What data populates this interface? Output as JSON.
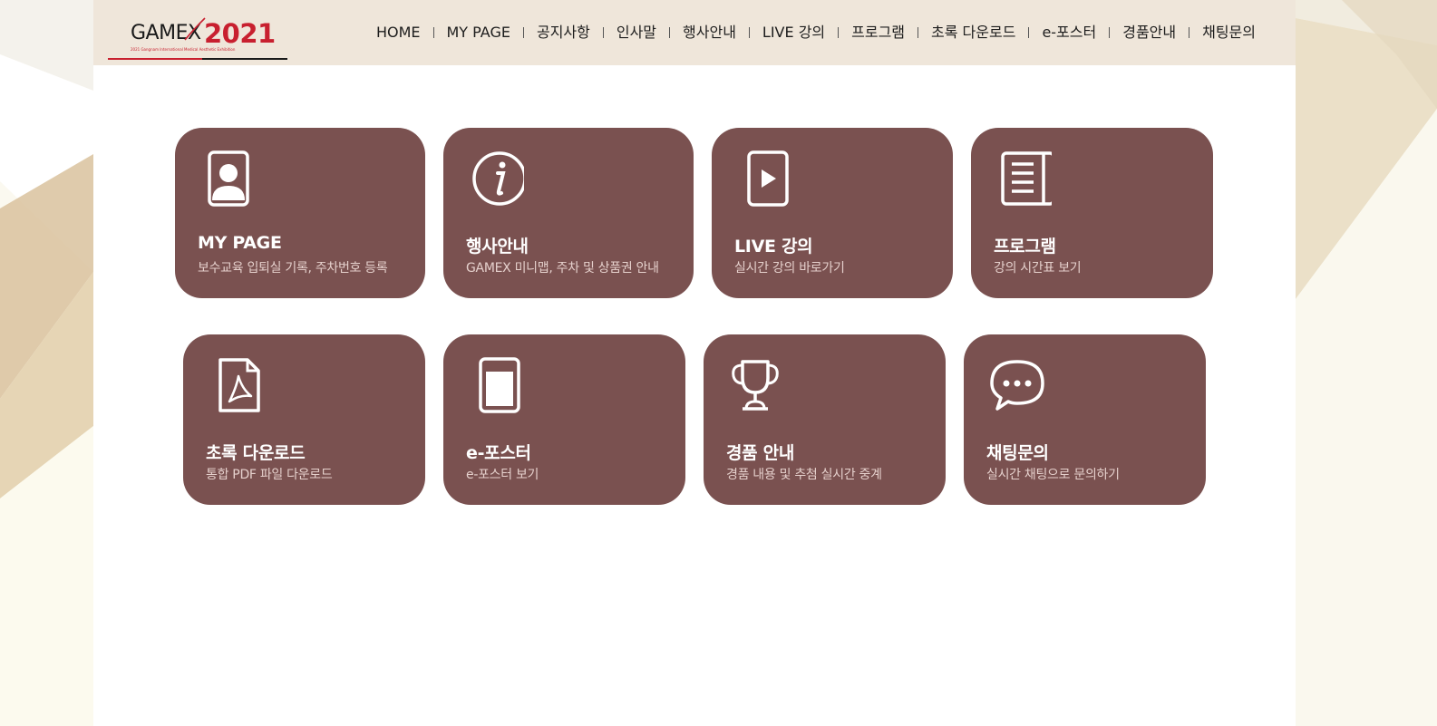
{
  "logo": {
    "brand": "GAMEX",
    "year": "2021",
    "tagline": "2021 Gangnam International Medical Aesthetic Exhibition"
  },
  "nav": {
    "items": [
      "HOME",
      "MY PAGE",
      "공지사항",
      "인사말",
      "행사안내",
      "LIVE 강의",
      "프로그램",
      "초록 다운로드",
      "e-포스터",
      "경품안내",
      "채팅문의"
    ]
  },
  "cards": [
    {
      "icon": "user-badge-icon",
      "title": "MY PAGE",
      "desc": "보수교육 입퇴실 기록, 주차번호 등록"
    },
    {
      "icon": "info-icon",
      "title": "행사안내",
      "desc": "GAMEX 미니맵, 주차 및 상품권 안내"
    },
    {
      "icon": "video-play-icon",
      "title": "LIVE 강의",
      "desc": "실시간 강의 바로가기"
    },
    {
      "icon": "book-list-icon",
      "title": "프로그램",
      "desc": "강의 시간표 보기"
    },
    {
      "icon": "pdf-file-icon",
      "title": "초록 다운로드",
      "desc": "통합 PDF 파일 다운로드"
    },
    {
      "icon": "tablet-icon",
      "title": "e-포스터",
      "desc": "e-포스터 보기"
    },
    {
      "icon": "trophy-icon",
      "title": "경품 안내",
      "desc": "경품 내용 및 추첨 실시간 중계"
    },
    {
      "icon": "chat-bubble-icon",
      "title": "채팅문의",
      "desc": "실시간 채팅으로 문의하기"
    }
  ],
  "colors": {
    "card": "#7a5150",
    "header": "#efe6da",
    "brand_red": "#c8202f"
  }
}
